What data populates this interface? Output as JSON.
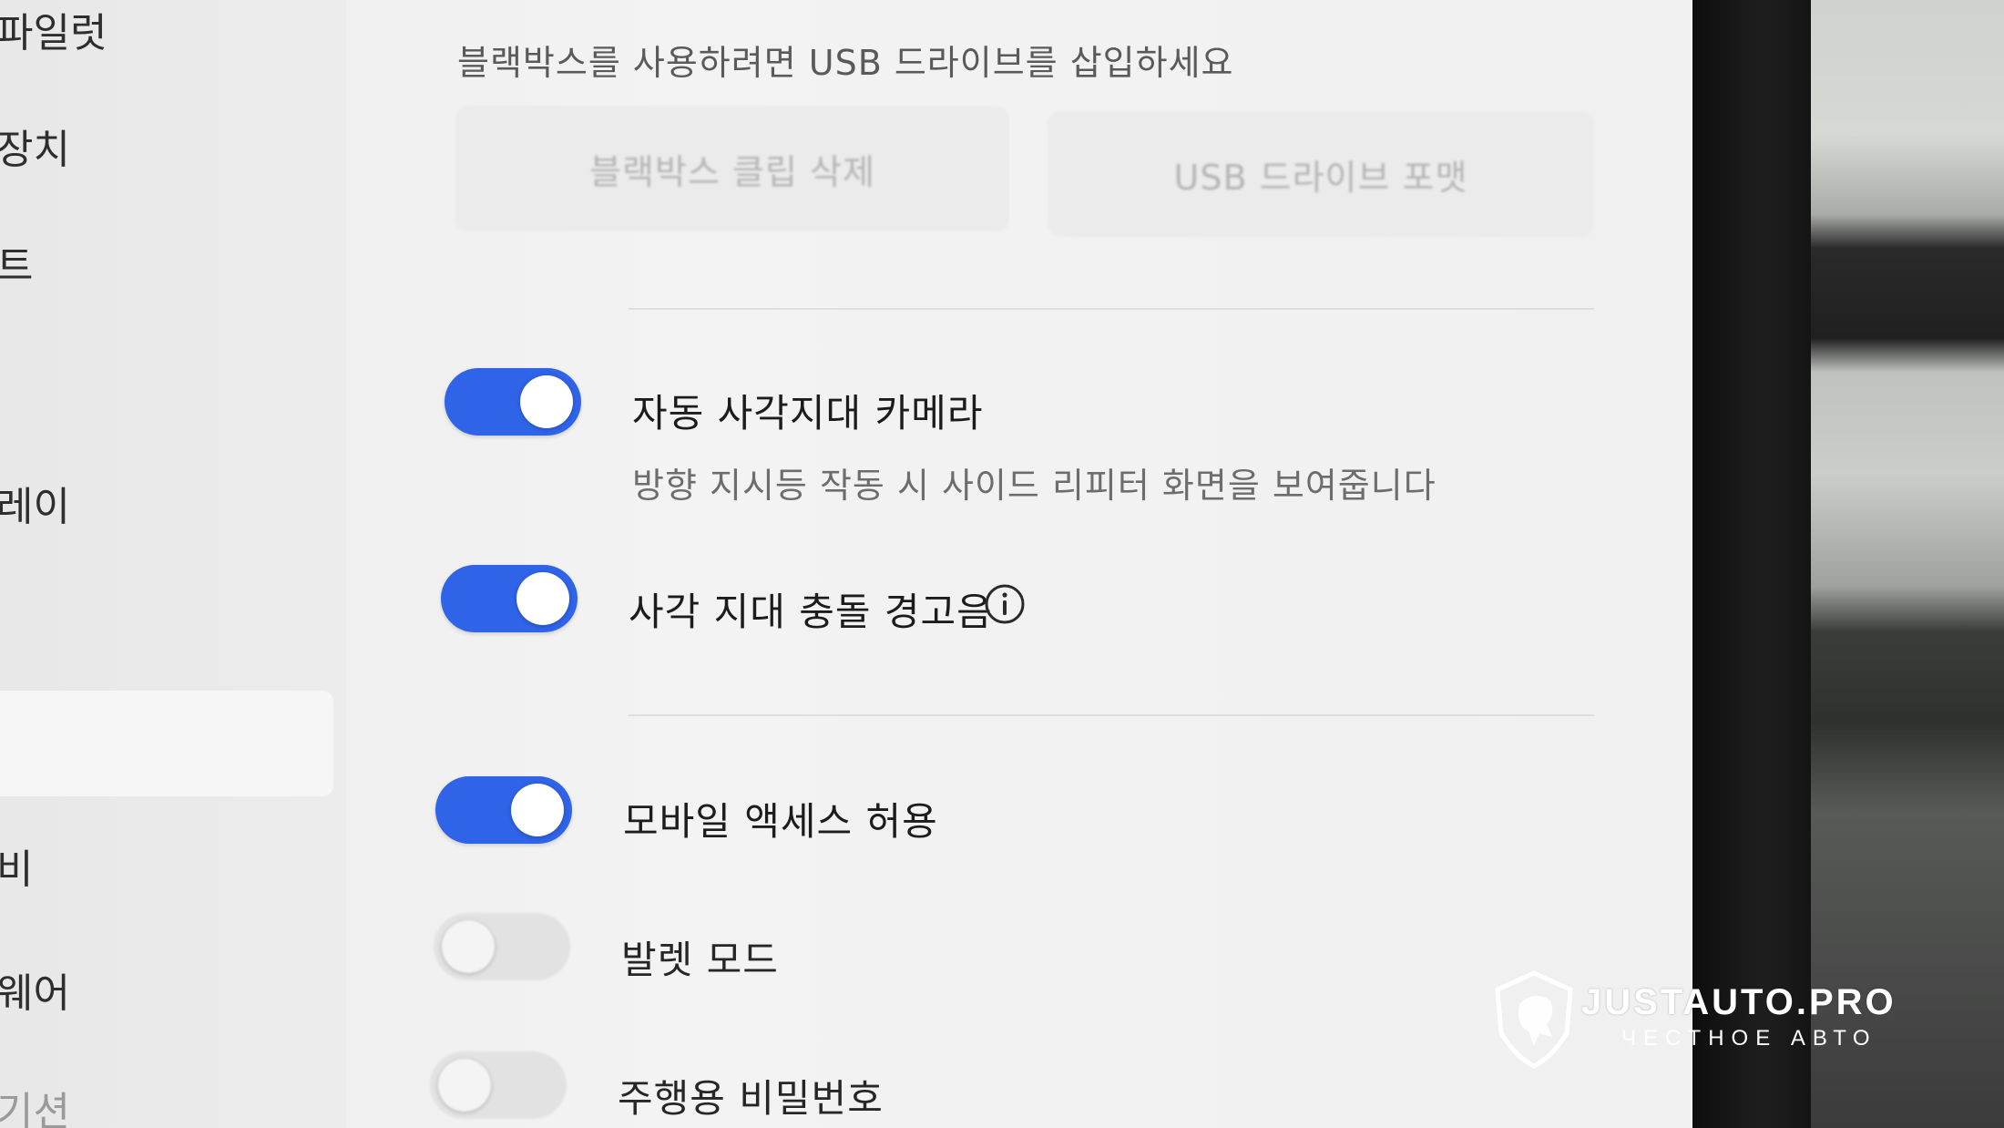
{
  "sidebar": {
    "items": [
      {
        "label": "파일럿"
      },
      {
        "label": "장치"
      },
      {
        "label": "트"
      },
      {
        "label": "레이"
      },
      {
        "label": "비"
      },
      {
        "label": "웨어"
      },
      {
        "label": "기션"
      }
    ]
  },
  "blackbox": {
    "usb_message": "블랙박스를 사용하려면 USB 드라이브를 삽입하세요",
    "delete_clips_label": "블랙박스 클립 삭제",
    "format_usb_label": "USB 드라이브 포맷"
  },
  "settings": {
    "auto_blind_spot_camera": {
      "label": "자동 사각지대 카메라",
      "description": "방향 지시등 작동 시 사이드 리피터 화면을 보여줍니다",
      "enabled": true
    },
    "blind_spot_warning_chime": {
      "label": "사각 지대 충돌 경고음",
      "enabled": true
    },
    "mobile_access": {
      "label": "모바일 액세스 허용",
      "enabled": true
    },
    "valet_mode": {
      "label": "발렛 모드",
      "enabled": false
    },
    "pin_to_drive": {
      "label": "주행용 비밀번호",
      "enabled": false
    }
  },
  "watermark": {
    "title": "JUSTAUTO.PRO",
    "subtitle": "ЧЕСТНОЕ АВТО"
  },
  "colors": {
    "toggle_on": "#2f63e8",
    "toggle_off": "#e2e2e2",
    "screen_bg": "#f0f0f0"
  }
}
